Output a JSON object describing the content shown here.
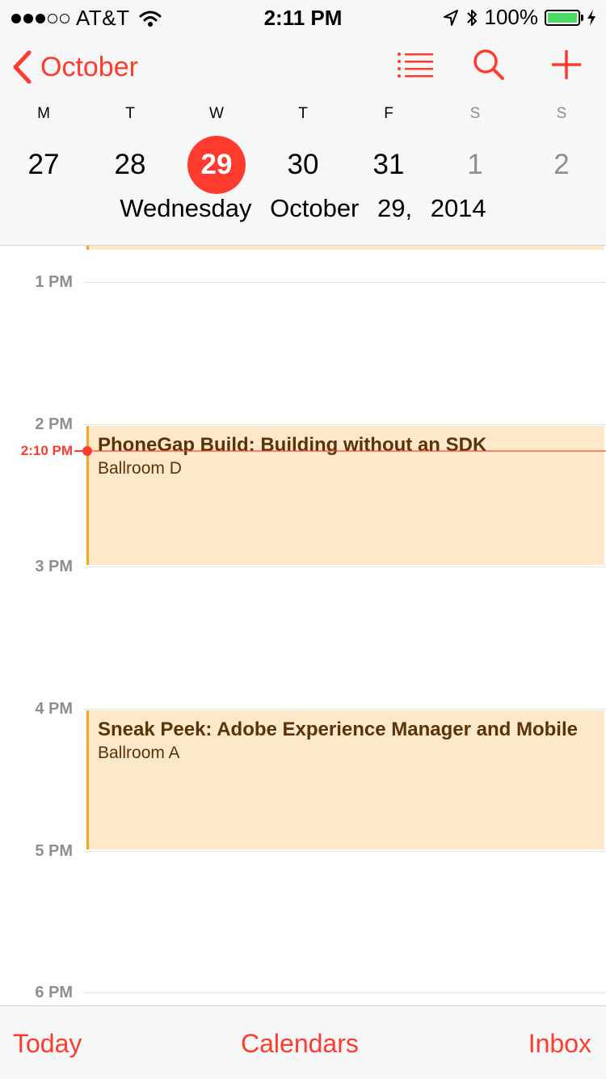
{
  "status_bar": {
    "carrier": "AT&T",
    "time": "2:11 PM",
    "battery": "100%",
    "signal_bars_filled": 3,
    "signal_bars_total": 5,
    "icons": [
      "wifi-icon",
      "location-arrow-icon",
      "bluetooth-icon",
      "battery-icon",
      "charging-bolt-icon"
    ]
  },
  "nav": {
    "back_label": "October",
    "icons": [
      "list-icon",
      "search-icon",
      "plus-icon"
    ],
    "accent_color": "#ff3b30"
  },
  "week": {
    "day_letters": [
      "M",
      "T",
      "W",
      "T",
      "F",
      "S",
      "S"
    ],
    "dates": [
      "27",
      "28",
      "29",
      "30",
      "31",
      "1",
      "2"
    ],
    "selected_index": 2,
    "weekday_name": "Wednesday",
    "full_date": "October 29, 2014"
  },
  "timeline": {
    "hours": [
      "1 PM",
      "2 PM",
      "3 PM",
      "4 PM",
      "5 PM",
      "6 PM"
    ],
    "current_time_label": "2:10 PM",
    "current_time_color": "#ff3b30",
    "events": [
      {
        "title": "PhoneGap Build: Building without an SDK",
        "location": "Ballroom D"
      },
      {
        "title": "Sneak Peek: Adobe Experience Manager and Mobile",
        "location": "Ballroom A"
      }
    ],
    "event_fill_color": "#fde9c9",
    "event_border_color": "#f5a623"
  },
  "tab_bar": {
    "today": "Today",
    "calendars": "Calendars",
    "inbox": "Inbox"
  }
}
